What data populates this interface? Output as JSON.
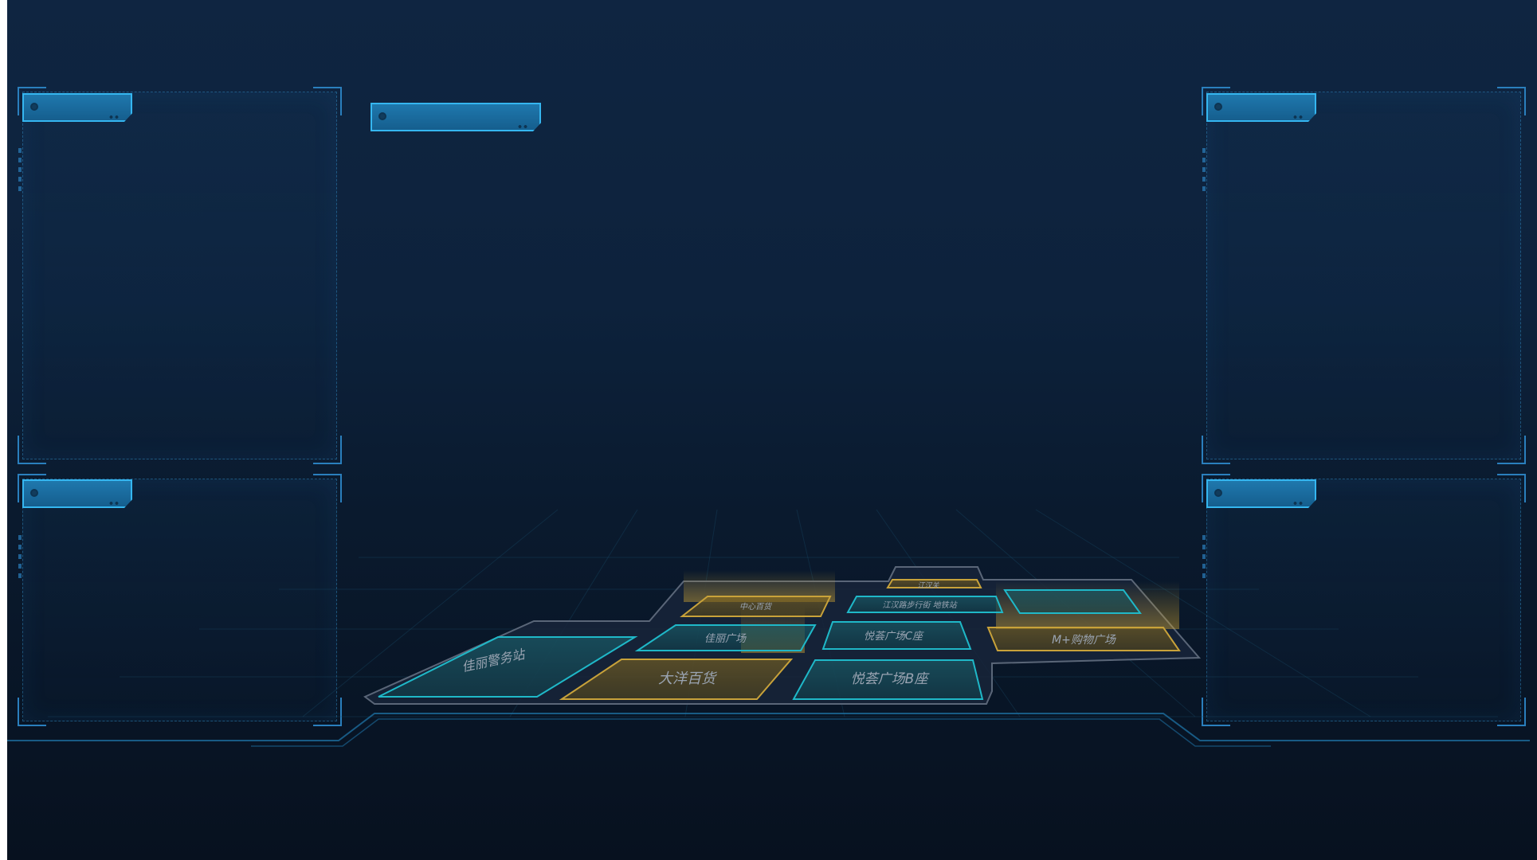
{
  "panels": {
    "left_top": {
      "title": ""
    },
    "left_bottom": {
      "title": ""
    },
    "center": {
      "title": ""
    },
    "right_top": {
      "title": ""
    },
    "right_bottom": {
      "title": ""
    }
  },
  "map": {
    "buildings": [
      {
        "id": "jiangli-police",
        "label": "佳丽警务站",
        "kind": "cyan"
      },
      {
        "id": "dayang",
        "label": "大洋百货",
        "kind": "gold"
      },
      {
        "id": "jiali-plaza",
        "label": "佳丽广场",
        "kind": "cyan"
      },
      {
        "id": "zhongxin",
        "label": "中心百货",
        "kind": "gold"
      },
      {
        "id": "yuehui-c",
        "label": "悦荟广场C座",
        "kind": "cyan"
      },
      {
        "id": "yuehui-b",
        "label": "悦荟广场B座",
        "kind": "cyan"
      },
      {
        "id": "jianghan-metro",
        "label": "江汉路步行街 地铁站",
        "kind": "cyan"
      },
      {
        "id": "jianghan-guan",
        "label": "江汉关",
        "kind": "gold"
      },
      {
        "id": "mplus",
        "label": "M+购物广场",
        "kind": "gold"
      }
    ]
  },
  "colors": {
    "accent": "#35b6f0",
    "panel_border": "#2a7fbd",
    "gold": "#c8a23a",
    "cyan": "#1fb8c8"
  }
}
